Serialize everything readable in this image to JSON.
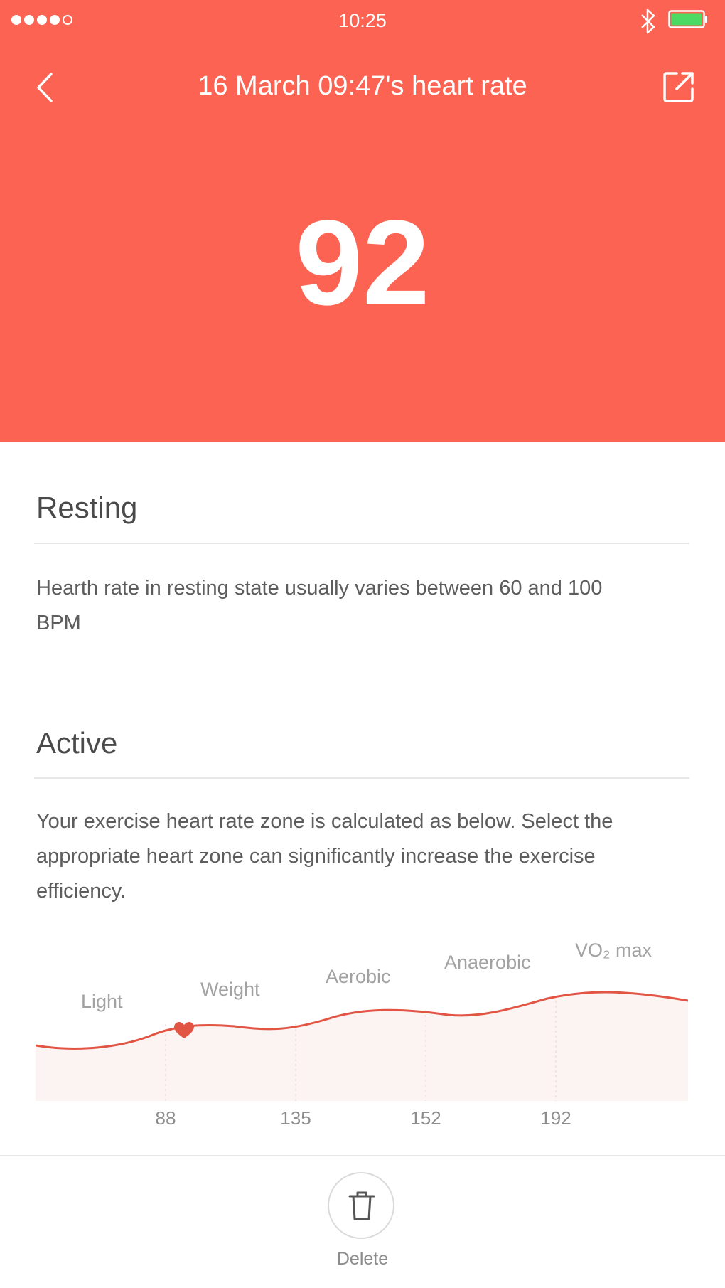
{
  "status_bar": {
    "time": "10:25",
    "signal_icon": "signal-dots-icon",
    "bluetooth_icon": "bluetooth-icon",
    "battery_icon": "battery-icon",
    "battery_color": "#4cd964"
  },
  "header": {
    "back_icon": "chevron-left-icon",
    "title": "16 March 09:47's heart rate",
    "share_icon": "share-icon",
    "value": "92",
    "background_color": "#fd6352"
  },
  "resting": {
    "heading": "Resting",
    "text_line1": "Hearth rate in resting state usually varies between 60 and 100",
    "text_line2": "BPM"
  },
  "active": {
    "heading": "Active",
    "text_line1": "Your exercise heart rate zone is calculated as below. Select the",
    "text_line2": "appropriate heart zone can significantly increase the exercise",
    "text_line3": "efficiency."
  },
  "zones": {
    "labels": [
      "Light",
      "Weight",
      "Aerobic",
      "Anaerobic",
      "VO₂ max"
    ],
    "ticks": [
      "88",
      "135",
      "152",
      "192"
    ],
    "marker_icon": "heart-icon",
    "curve_color": "#e25545"
  },
  "footer": {
    "delete_icon": "trash-icon",
    "delete_label": "Delete"
  }
}
